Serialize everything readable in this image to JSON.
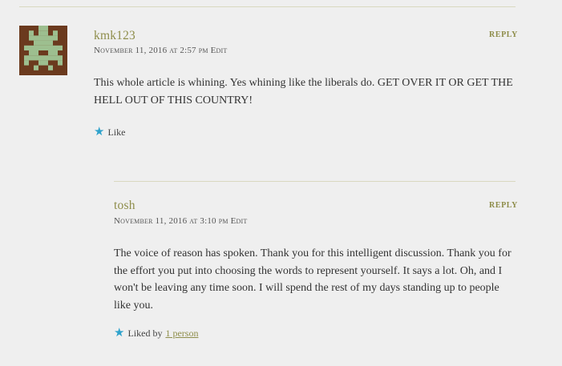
{
  "comments": [
    {
      "author": "kmk123",
      "reply_label": "REPLY",
      "date": "November 11, 2016",
      "at": "at",
      "time": "2:57 pm",
      "edit_label": "Edit",
      "body": "This whole article is whining. Yes whining like the liberals do. GET OVER IT OR GET THE HELL OUT OF THIS COUNTRY!",
      "like_label": "Like",
      "avatar_colors": {
        "background": "#6b3a1e",
        "figure": "#9dbf8f"
      }
    },
    {
      "author": "tosh",
      "reply_label": "REPLY",
      "date": "November 11, 2016",
      "at": "at",
      "time": "3:10 pm",
      "edit_label": "Edit",
      "body": "The voice of reason has spoken. Thank you for this intelligent discussion. Thank you for the effort you put into choosing the words to represent yourself. It says a lot. Oh, and I won't be leaving any time soon. I will spend the rest of my days standing up to people like you.",
      "liked_by_label": "Liked by",
      "liked_by_link": "1 person"
    }
  ],
  "icons": {
    "like": "star-icon"
  },
  "colors": {
    "accent": "#8e8d4a",
    "star": "#2ea2cc",
    "background": "#efefef"
  }
}
